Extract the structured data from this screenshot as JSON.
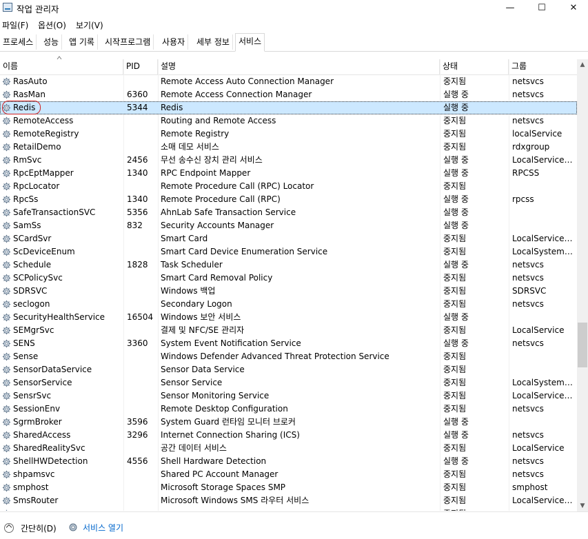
{
  "window": {
    "title": "작업 관리자",
    "minimize": "—",
    "maximize": "☐",
    "close": "✕"
  },
  "menu": [
    "파일(F)",
    "옵션(O)",
    "보기(V)"
  ],
  "tabs": [
    "프로세스",
    "성능",
    "앱 기록",
    "시작프로그램",
    "사용자",
    "세부 정보",
    "서비스"
  ],
  "active_tab": "서비스",
  "columns": {
    "name": "이름",
    "pid": "PID",
    "desc": "설명",
    "status": "상태",
    "group": "그룹"
  },
  "rows": [
    {
      "name": "RasAuto",
      "pid": "",
      "desc": "Remote Access Auto Connection Manager",
      "status": "중지됨",
      "group": "netsvcs"
    },
    {
      "name": "RasMan",
      "pid": "6360",
      "desc": "Remote Access Connection Manager",
      "status": "실행 중",
      "group": "netsvcs"
    },
    {
      "name": "Redis",
      "pid": "5344",
      "desc": "Redis",
      "status": "실행 중",
      "group": "",
      "selected": true
    },
    {
      "name": "RemoteAccess",
      "pid": "",
      "desc": "Routing and Remote Access",
      "status": "중지됨",
      "group": "netsvcs"
    },
    {
      "name": "RemoteRegistry",
      "pid": "",
      "desc": "Remote Registry",
      "status": "중지됨",
      "group": "localService"
    },
    {
      "name": "RetailDemo",
      "pid": "",
      "desc": "소매 데모 서비스",
      "status": "중지됨",
      "group": "rdxgroup"
    },
    {
      "name": "RmSvc",
      "pid": "2456",
      "desc": "무선 송수신 장치 관리 서비스",
      "status": "실행 중",
      "group": "LocalServiceN..."
    },
    {
      "name": "RpcEptMapper",
      "pid": "1340",
      "desc": "RPC Endpoint Mapper",
      "status": "실행 중",
      "group": "RPCSS"
    },
    {
      "name": "RpcLocator",
      "pid": "",
      "desc": "Remote Procedure Call (RPC) Locator",
      "status": "중지됨",
      "group": ""
    },
    {
      "name": "RpcSs",
      "pid": "1340",
      "desc": "Remote Procedure Call (RPC)",
      "status": "실행 중",
      "group": "rpcss"
    },
    {
      "name": "SafeTransactionSVC",
      "pid": "5356",
      "desc": "AhnLab Safe Transaction Service",
      "status": "실행 중",
      "group": ""
    },
    {
      "name": "SamSs",
      "pid": "832",
      "desc": "Security Accounts Manager",
      "status": "실행 중",
      "group": ""
    },
    {
      "name": "SCardSvr",
      "pid": "",
      "desc": "Smart Card",
      "status": "중지됨",
      "group": "LocalServiceA..."
    },
    {
      "name": "ScDeviceEnum",
      "pid": "",
      "desc": "Smart Card Device Enumeration Service",
      "status": "중지됨",
      "group": "LocalSystemN..."
    },
    {
      "name": "Schedule",
      "pid": "1828",
      "desc": "Task Scheduler",
      "status": "실행 중",
      "group": "netsvcs"
    },
    {
      "name": "SCPolicySvc",
      "pid": "",
      "desc": "Smart Card Removal Policy",
      "status": "중지됨",
      "group": "netsvcs"
    },
    {
      "name": "SDRSVC",
      "pid": "",
      "desc": "Windows 백업",
      "status": "중지됨",
      "group": "SDRSVC"
    },
    {
      "name": "seclogon",
      "pid": "",
      "desc": "Secondary Logon",
      "status": "중지됨",
      "group": "netsvcs"
    },
    {
      "name": "SecurityHealthService",
      "pid": "16504",
      "desc": "Windows 보안 서비스",
      "status": "실행 중",
      "group": ""
    },
    {
      "name": "SEMgrSvc",
      "pid": "",
      "desc": "결제 및 NFC/SE 관리자",
      "status": "중지됨",
      "group": "LocalService"
    },
    {
      "name": "SENS",
      "pid": "3360",
      "desc": "System Event Notification Service",
      "status": "실행 중",
      "group": "netsvcs"
    },
    {
      "name": "Sense",
      "pid": "",
      "desc": "Windows Defender Advanced Threat Protection Service",
      "status": "중지됨",
      "group": ""
    },
    {
      "name": "SensorDataService",
      "pid": "",
      "desc": "Sensor Data Service",
      "status": "중지됨",
      "group": ""
    },
    {
      "name": "SensorService",
      "pid": "",
      "desc": "Sensor Service",
      "status": "중지됨",
      "group": "LocalSystemN..."
    },
    {
      "name": "SensrSvc",
      "pid": "",
      "desc": "Sensor Monitoring Service",
      "status": "중지됨",
      "group": "LocalServiceA..."
    },
    {
      "name": "SessionEnv",
      "pid": "",
      "desc": "Remote Desktop Configuration",
      "status": "중지됨",
      "group": "netsvcs"
    },
    {
      "name": "SgrmBroker",
      "pid": "3596",
      "desc": "System Guard 런타임 모니터 브로커",
      "status": "실행 중",
      "group": ""
    },
    {
      "name": "SharedAccess",
      "pid": "3296",
      "desc": "Internet Connection Sharing (ICS)",
      "status": "실행 중",
      "group": "netsvcs"
    },
    {
      "name": "SharedRealitySvc",
      "pid": "",
      "desc": "공간 데이터 서비스",
      "status": "중지됨",
      "group": "LocalService"
    },
    {
      "name": "ShellHWDetection",
      "pid": "4556",
      "desc": "Shell Hardware Detection",
      "status": "실행 중",
      "group": "netsvcs"
    },
    {
      "name": "shpamsvc",
      "pid": "",
      "desc": "Shared PC Account Manager",
      "status": "중지됨",
      "group": "netsvcs"
    },
    {
      "name": "smphost",
      "pid": "",
      "desc": "Microsoft Storage Spaces SMP",
      "status": "중지됨",
      "group": "smphost"
    },
    {
      "name": "SmsRouter",
      "pid": "",
      "desc": "Microsoft Windows SMS 라우터 서비스",
      "status": "중지됨",
      "group": "LocalServiceN..."
    },
    {
      "name": "",
      "pid": "",
      "desc": "",
      "status": "중지됨",
      "group": ""
    }
  ],
  "footer": {
    "fewer_details": "간단히(D)",
    "open_services": "서비스 열기"
  }
}
